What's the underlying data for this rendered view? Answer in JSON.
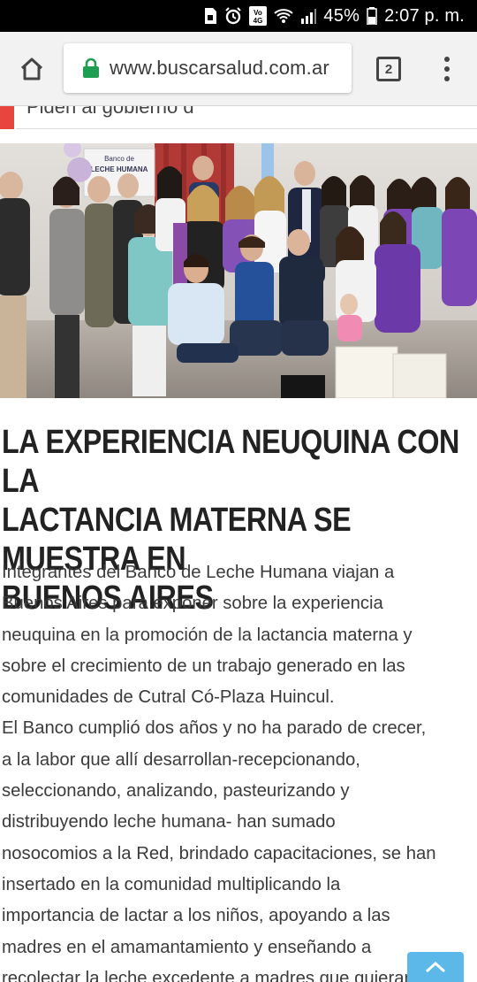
{
  "status_bar": {
    "battery": "45%",
    "time": "2:07 p. m.",
    "network_label": "4G"
  },
  "browser": {
    "url": "www.buscarsalud.com.ar",
    "tab_count": "2"
  },
  "ticker": {
    "text": "Piden al gobierno d"
  },
  "photo": {
    "banner_text_1": "Banco de",
    "banner_text_2": "LECHE HUMANA"
  },
  "article": {
    "headline_lines": [
      "LA EXPERIENCIA NEUQUINA CON LA",
      "LACTANCIA MATERNA SE MUESTRA EN",
      "BUENOS AIRES"
    ],
    "lines": [
      "Integrantes del Banco de Leche Humana viajan a",
      "Buenos Aires para exponer sobre la experiencia",
      "neuquina en la promoción de la lactancia materna y",
      "sobre el crecimiento de un trabajo generado en las",
      "comunidades de Cutral Có-Plaza Huincul.",
      "El Banco cumplió dos años y no ha parado de crecer,",
      "a la labor que allí desarrollan-recepcionando,",
      "seleccionando, analizando, pasteurizando y",
      "distribuyendo leche humana- han sumado",
      "nosocomios a la Red, brindado capacitaciones, se han",
      "insertado en la comunidad multiplicando la",
      "importancia de lactar a los niños, apoyando a las",
      "madres en el amamantamiento y enseñando a",
      "recolectar la leche excedente a madres que quieran"
    ]
  },
  "colors": {
    "ticker_accent": "#e8453c",
    "lock_green": "#1e9e50",
    "scroll_top": "#5bb8e8"
  }
}
